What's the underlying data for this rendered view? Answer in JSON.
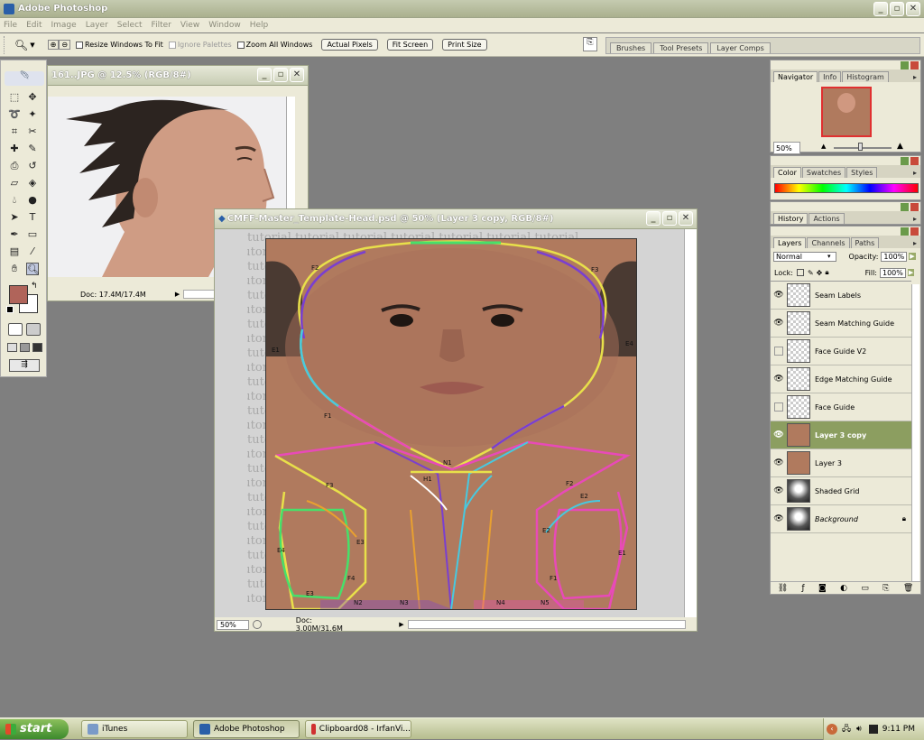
{
  "app": {
    "title": "Adobe Photoshop"
  },
  "menu": [
    "File",
    "Edit",
    "Image",
    "Layer",
    "Select",
    "Filter",
    "View",
    "Window",
    "Help"
  ],
  "options": {
    "resize_windows": "Resize Windows To Fit",
    "ignore_palettes": "Ignore Palettes",
    "zoom_all": "Zoom All Windows",
    "actual_pixels": "Actual Pixels",
    "fit_screen": "Fit Screen",
    "print_size": "Print Size"
  },
  "palette_well": [
    "Brushes",
    "Tool Presets",
    "Layer Comps"
  ],
  "colors": {
    "foreground": "#b0645a",
    "background": "#ffffff",
    "skin": "#b07a5e",
    "selected_layer": "#8c9e60"
  },
  "doc1": {
    "title": "161..JPG @ 12.5% (RGB/8#)",
    "status": "Doc: 17.4M/17.4M"
  },
  "doc2": {
    "title": "CMFF-Master_Template-Head.psd @ 50% (Layer 3 copy, RGB/8#)",
    "zoom": "50%",
    "status": "Doc: 3.00M/31.6M",
    "watermark": "tutorial",
    "labels": [
      "F2",
      "F3",
      "E1",
      "E4",
      "F1",
      "N1",
      "H1",
      "F3",
      "E4",
      "E3",
      "E3",
      "F4",
      "N2",
      "N3",
      "F2",
      "E2",
      "E2",
      "E1",
      "F1",
      "N4",
      "N5"
    ]
  },
  "navigator": {
    "tabs": [
      "Navigator",
      "Info",
      "Histogram"
    ],
    "zoom": "50%"
  },
  "color_panel": {
    "tabs": [
      "Color",
      "Swatches",
      "Styles"
    ]
  },
  "history_panel": {
    "tabs": [
      "History",
      "Actions"
    ]
  },
  "layers_panel": {
    "tabs": [
      "Layers",
      "Channels",
      "Paths"
    ],
    "blend_mode": "Normal",
    "opacity_label": "Opacity:",
    "opacity": "100%",
    "lock_label": "Lock:",
    "fill_label": "Fill:",
    "fill": "100%",
    "layers": [
      {
        "name": "Seam Labels",
        "visible": true,
        "thumb": "checker"
      },
      {
        "name": "Seam Matching Guide",
        "visible": true,
        "thumb": "checker"
      },
      {
        "name": "Face Guide V2",
        "visible": false,
        "thumb": "checker"
      },
      {
        "name": "Edge Matching Guide",
        "visible": true,
        "thumb": "checker"
      },
      {
        "name": "Face Guide",
        "visible": false,
        "thumb": "checker"
      },
      {
        "name": "Layer 3 copy",
        "visible": true,
        "thumb": "skin",
        "selected": true
      },
      {
        "name": "Layer 3",
        "visible": true,
        "thumb": "skin"
      },
      {
        "name": "Shaded Grid",
        "visible": true,
        "thumb": "grid"
      },
      {
        "name": "Background",
        "visible": true,
        "thumb": "grid",
        "locked": true
      }
    ]
  },
  "taskbar": {
    "start": "start",
    "tasks": [
      "iTunes",
      "Adobe Photoshop",
      "Clipboard08 - IrfanVi..."
    ],
    "time": "9:11 PM"
  }
}
